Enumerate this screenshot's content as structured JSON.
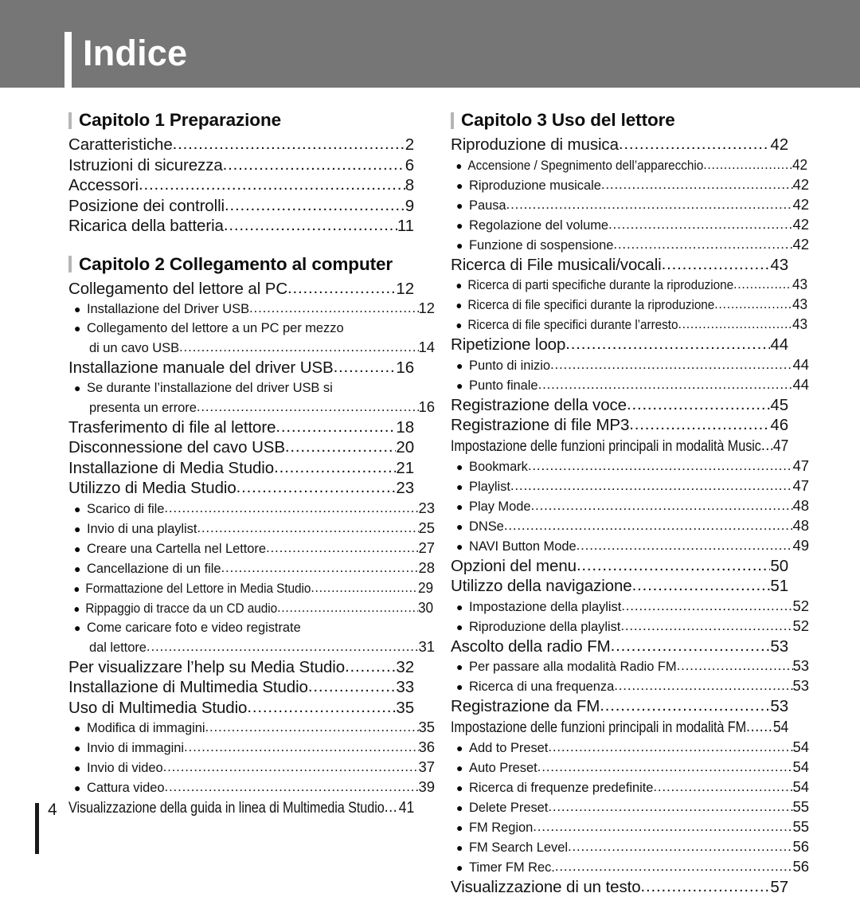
{
  "header": {
    "title": "Indice"
  },
  "footer": {
    "page_number": "4"
  },
  "bullet_glyph": "●",
  "columns": {
    "left": [
      {
        "type": "chapter",
        "title": "Capitolo 1 Preparazione"
      },
      {
        "type": "entry",
        "level": 1,
        "label": "Caratteristiche",
        "page": "2"
      },
      {
        "type": "entry",
        "level": 1,
        "label": "Istruzioni di sicurezza",
        "page": "6"
      },
      {
        "type": "entry",
        "level": 1,
        "label": "Accessori ",
        "page": "8"
      },
      {
        "type": "entry",
        "level": 1,
        "label": "Posizione dei controlli ",
        "page": "9"
      },
      {
        "type": "entry",
        "level": 1,
        "label": "Ricarica della batteria ",
        "page": "11"
      },
      {
        "type": "chapter",
        "title": "Capitolo 2 Collegamento al computer"
      },
      {
        "type": "entry",
        "level": 1,
        "label": "Collegamento del lettore al PC ",
        "page": "12"
      },
      {
        "type": "entry",
        "level": 2,
        "label": "Installazione del Driver USB ",
        "page": "12"
      },
      {
        "type": "text",
        "level": 2,
        "label": "Collegamento del lettore a un PC per mezzo"
      },
      {
        "type": "entry",
        "level": 2,
        "continuation": true,
        "label": "di un cavo USB",
        "page": "14"
      },
      {
        "type": "entry",
        "level": 1,
        "label": "Installazione manuale del driver USB ",
        "page": "16"
      },
      {
        "type": "text",
        "level": 2,
        "label": "Se durante l’installazione del driver USB si"
      },
      {
        "type": "entry",
        "level": 2,
        "continuation": true,
        "label": "presenta un errore ",
        "page": "16"
      },
      {
        "type": "entry",
        "level": 1,
        "label": "Trasferimento di file al lettore",
        "page": "18"
      },
      {
        "type": "entry",
        "level": 1,
        "label": "Disconnessione del cavo USB",
        "page": "20"
      },
      {
        "type": "entry",
        "level": 1,
        "label": "Installazione di Media Studio ",
        "page": "21"
      },
      {
        "type": "entry",
        "level": 1,
        "label": "Utilizzo di Media Studio",
        "page": "23"
      },
      {
        "type": "entry",
        "level": 2,
        "label": "Scarico di file  ",
        "page": "23"
      },
      {
        "type": "entry",
        "level": 2,
        "label": "Invio di una playlist",
        "page": "25"
      },
      {
        "type": "entry",
        "level": 2,
        "label": "Creare una Cartella nel Lettore ",
        "page": "27"
      },
      {
        "type": "entry",
        "level": 2,
        "label": "Cancellazione di un file ",
        "page": "28"
      },
      {
        "type": "entry",
        "level": 2,
        "condensed": true,
        "label": "Formattazione del Lettore in Media Studio",
        "page": "29"
      },
      {
        "type": "entry",
        "level": 2,
        "condensed": true,
        "label": "Rippaggio di tracce da un CD audio ",
        "page": "30"
      },
      {
        "type": "text",
        "level": 2,
        "label": "Come caricare foto e video registrate"
      },
      {
        "type": "entry",
        "level": 2,
        "continuation": true,
        "label": "dal lettore ",
        "page": "31"
      },
      {
        "type": "entry",
        "level": 1,
        "label": "Per visualizzare l’help su Media Studio  ",
        "page": "32"
      },
      {
        "type": "entry",
        "level": 1,
        "label": "Installazione di Multimedia Studio",
        "page": "33"
      },
      {
        "type": "entry",
        "level": 1,
        "label": "Uso di Multimedia Studio ",
        "page": "35"
      },
      {
        "type": "entry",
        "level": 2,
        "label": "Modifica di immagini",
        "page": "35"
      },
      {
        "type": "entry",
        "level": 2,
        "label": "Invio di immagini ",
        "page": "36"
      },
      {
        "type": "entry",
        "level": 2,
        "label": "Invio di video ",
        "page": "37"
      },
      {
        "type": "entry",
        "level": 2,
        "label": "Cattura video ",
        "page": "39"
      },
      {
        "type": "entry",
        "level": 1,
        "condensed": true,
        "label": "Visualizzazione della guida in linea di Multimedia Studio",
        "page": "41"
      }
    ],
    "right": [
      {
        "type": "chapter",
        "title": "Capitolo 3 Uso del lettore"
      },
      {
        "type": "entry",
        "level": 1,
        "label": "Riproduzione di musica  ",
        "page": "42"
      },
      {
        "type": "entry",
        "level": 2,
        "condensed": true,
        "label": "Accensione / Spegnimento dell’apparecchio ",
        "page": "42"
      },
      {
        "type": "entry",
        "level": 2,
        "label": "Riproduzione musicale ",
        "page": "42"
      },
      {
        "type": "entry",
        "level": 2,
        "label": "Pausa ",
        "page": "42"
      },
      {
        "type": "entry",
        "level": 2,
        "label": "Regolazione del volume ",
        "page": "42"
      },
      {
        "type": "entry",
        "level": 2,
        "label": "Funzione di sospensione",
        "page": "42"
      },
      {
        "type": "entry",
        "level": 1,
        "label": "Ricerca di File musicali/vocali ",
        "page": "43"
      },
      {
        "type": "entry",
        "level": 2,
        "condensed": true,
        "label": "Ricerca di parti specifiche durante la riproduzione",
        "page": "43"
      },
      {
        "type": "entry",
        "level": 2,
        "condensed": true,
        "label": "Ricerca di file specifici durante la riproduzione",
        "page": "43"
      },
      {
        "type": "entry",
        "level": 2,
        "condensed": true,
        "label": "Ricerca di file specifici durante l’arresto ",
        "page": "43"
      },
      {
        "type": "entry",
        "level": 1,
        "label": "Ripetizione loop ",
        "page": "44"
      },
      {
        "type": "entry",
        "level": 2,
        "label": "Punto di inizio",
        "page": "44"
      },
      {
        "type": "entry",
        "level": 2,
        "label": "Punto finale",
        "page": "44"
      },
      {
        "type": "entry",
        "level": 1,
        "label": "Registrazione della voce",
        "page": "45"
      },
      {
        "type": "entry",
        "level": 1,
        "label": "Registrazione di file MP3 ",
        "page": "46"
      },
      {
        "type": "entry",
        "level": 1,
        "condensed": true,
        "label": "Impostazione delle funzioni principali in modalità Music ",
        "page": "47"
      },
      {
        "type": "entry",
        "level": 2,
        "label": "Bookmark",
        "page": "47"
      },
      {
        "type": "entry",
        "level": 2,
        "label": "Playlist ",
        "page": "47"
      },
      {
        "type": "entry",
        "level": 2,
        "label": "Play Mode ",
        "page": "48"
      },
      {
        "type": "entry",
        "level": 2,
        "label": "DNSe",
        "page": "48"
      },
      {
        "type": "entry",
        "level": 2,
        "label": "NAVI Button Mode ",
        "page": "49"
      },
      {
        "type": "entry",
        "level": 1,
        "label": "Opzioni del menu ",
        "page": "50"
      },
      {
        "type": "entry",
        "level": 1,
        "label": "Utilizzo della navigazione",
        "page": "51"
      },
      {
        "type": "entry",
        "level": 2,
        "label": "Impostazione della playlist ",
        "page": "52"
      },
      {
        "type": "entry",
        "level": 2,
        "label": "Riproduzione della playlist",
        "page": "52"
      },
      {
        "type": "entry",
        "level": 1,
        "label": "Ascolto della radio FM ",
        "page": "53"
      },
      {
        "type": "entry",
        "level": 2,
        "label": "Per passare alla modalità Radio FM",
        "page": "53"
      },
      {
        "type": "entry",
        "level": 2,
        "label": "Ricerca di una frequenza",
        "page": "53"
      },
      {
        "type": "entry",
        "level": 1,
        "label": "Registrazione da FM",
        "page": "53"
      },
      {
        "type": "entry",
        "level": 1,
        "condensed": true,
        "label": "Impostazione delle funzioni principali in modalità FM  ",
        "page": "54"
      },
      {
        "type": "entry",
        "level": 2,
        "label": "Add to Preset ",
        "page": "54"
      },
      {
        "type": "entry",
        "level": 2,
        "label": "Auto Preset",
        "page": "54"
      },
      {
        "type": "entry",
        "level": 2,
        "label": "Ricerca di frequenze predefinite  ",
        "page": "54"
      },
      {
        "type": "entry",
        "level": 2,
        "label": "Delete Preset ",
        "page": "55"
      },
      {
        "type": "entry",
        "level": 2,
        "label": "FM Region",
        "page": "55"
      },
      {
        "type": "entry",
        "level": 2,
        "label": "FM Search Level",
        "page": "56"
      },
      {
        "type": "entry",
        "level": 2,
        "label": "Timer FM Rec. ",
        "page": "56"
      },
      {
        "type": "entry",
        "level": 1,
        "label": "Visualizzazione di un testo ",
        "page": "57"
      }
    ]
  }
}
